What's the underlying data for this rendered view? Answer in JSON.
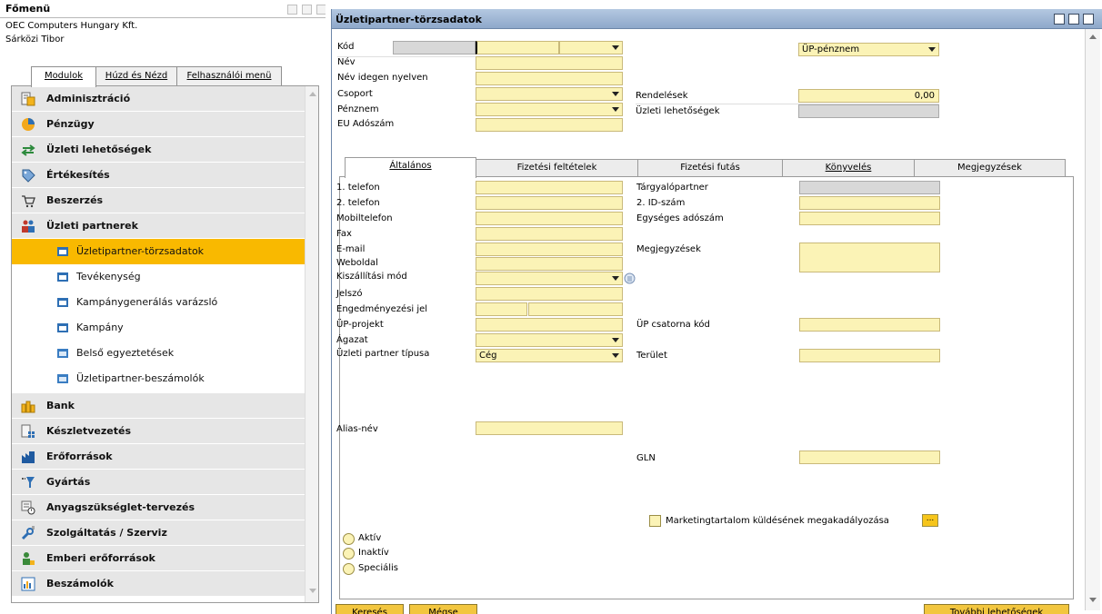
{
  "main_menu": {
    "title": "Főmenü",
    "company": "OEC Computers Hungary Kft.",
    "user": "Sárközi Tibor",
    "tabs": [
      {
        "label": "Modulok"
      },
      {
        "label": "Húzd és Nézd"
      },
      {
        "label": "Felhasználói menü"
      }
    ],
    "modules": [
      {
        "label": "Adminisztráció",
        "icon": "admin-icon"
      },
      {
        "label": "Pénzügy",
        "icon": "finance-pie-icon"
      },
      {
        "label": "Üzleti lehetőségek",
        "icon": "opportunities-icon"
      },
      {
        "label": "Értékesítés",
        "icon": "sales-tag-icon"
      },
      {
        "label": "Beszerzés",
        "icon": "purchase-cart-icon"
      },
      {
        "label": "Üzleti partnerek",
        "icon": "business-partners-icon"
      }
    ],
    "partner_submenu": [
      {
        "label": "Üzletipartner-törzsadatok",
        "selected": true
      },
      {
        "label": "Tevékenység"
      },
      {
        "label": "Kampánygenerálás varázsló"
      },
      {
        "label": "Kampány"
      },
      {
        "label": "Belső egyeztetések"
      },
      {
        "label": "Üzletipartner-beszámolók"
      }
    ],
    "modules_after": [
      {
        "label": "Bank",
        "icon": "bank-icon"
      },
      {
        "label": "Készletvezetés",
        "icon": "inventory-icon"
      },
      {
        "label": "Erőforrások",
        "icon": "resources-icon"
      },
      {
        "label": "Gyártás",
        "icon": "production-icon"
      },
      {
        "label": "Anyagszükséglet-tervezés",
        "icon": "mrp-icon"
      },
      {
        "label": "Szolgáltatás / Szerviz",
        "icon": "service-wrench-icon"
      },
      {
        "label": "Emberi erőforrások",
        "icon": "hr-people-icon"
      },
      {
        "label": "Beszámolók",
        "icon": "reports-icon"
      }
    ]
  },
  "window": {
    "title": "Üzletipartner-törzsadatok",
    "header": {
      "kod_label": "Kód",
      "nev_label": "Név",
      "idegen_label": "Név idegen nyelven",
      "csoport_label": "Csoport",
      "penznem_label": "Pénznem",
      "eu_label": "EU Adószám",
      "up_penznem_value": "ÜP-pénznem",
      "rendelesek_label": "Rendelések",
      "rendelesek_value": "0,00",
      "lehetosegek_label": "Üzleti lehetőségek"
    },
    "tabs": [
      {
        "label": "Általános"
      },
      {
        "label": "Fizetési feltételek"
      },
      {
        "label": "Fizetési futás"
      },
      {
        "label": "Könyvelés"
      },
      {
        "label": "Megjegyzések"
      }
    ],
    "general": {
      "telefon1": "1. telefon",
      "telefon2": "2. telefon",
      "mobil": "Mobiltelefon",
      "fax": "Fax",
      "email": "E-mail",
      "weboldal": "Weboldal",
      "kiszallitas": "Kiszállítási mód",
      "jelszo": "Jelszó",
      "engedmeny": "Engedményezési jel",
      "projekt": "ÜP-projekt",
      "agazat": "Ágazat",
      "tipus": "Üzleti partner típusa",
      "tipus_value": "Cég",
      "alias": "Alias-név",
      "targyalo": "Tárgyalópartner",
      "id2": "2. ID-szám",
      "egyseges": "Egységes adószám",
      "megjegyzesek": "Megjegyzések",
      "csatorna": "ÜP csatorna kód",
      "terulet": "Terület",
      "gln": "GLN",
      "marketing": "Marketingtartalom küldésének megakadályozása",
      "dots": "..."
    },
    "status_options": [
      {
        "label": "Aktív"
      },
      {
        "label": "Inaktív"
      },
      {
        "label": "Speciális"
      }
    ],
    "buttons": {
      "ok": "Keresés",
      "cancel": "Mégse",
      "related": "További lehetőségek"
    }
  }
}
